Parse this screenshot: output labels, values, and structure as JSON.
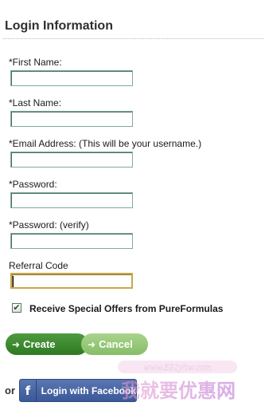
{
  "section": {
    "title": "Login Information"
  },
  "form": {
    "first_name": {
      "label": "*First Name:",
      "value": ""
    },
    "last_name": {
      "label": "*Last Name:",
      "value": ""
    },
    "email": {
      "label": "*Email Address:  (This will be your username.)",
      "value": ""
    },
    "password": {
      "label": "*Password:",
      "value": ""
    },
    "password_verify": {
      "label": "*Password: (verify)",
      "value": ""
    },
    "referral_code": {
      "label": "Referral Code",
      "value": ""
    }
  },
  "offers": {
    "checked": true,
    "label": "Receive Special Offers from PureFormulas"
  },
  "buttons": {
    "create_label": "Create",
    "cancel_label": "Cancel",
    "arrow_icon": "arrow-right-icon"
  },
  "social": {
    "or_text": "or",
    "facebook_label": "Login with Facebook",
    "facebook_icon": "facebook-icon",
    "facebook_color": "#3b5998"
  },
  "watermark": {
    "url": "www.591yhw.com",
    "text": "我就要优惠网"
  },
  "colors": {
    "create_green": "#3f8a30",
    "cancel_green": "#97c878",
    "focus_border": "#c8a84a"
  }
}
